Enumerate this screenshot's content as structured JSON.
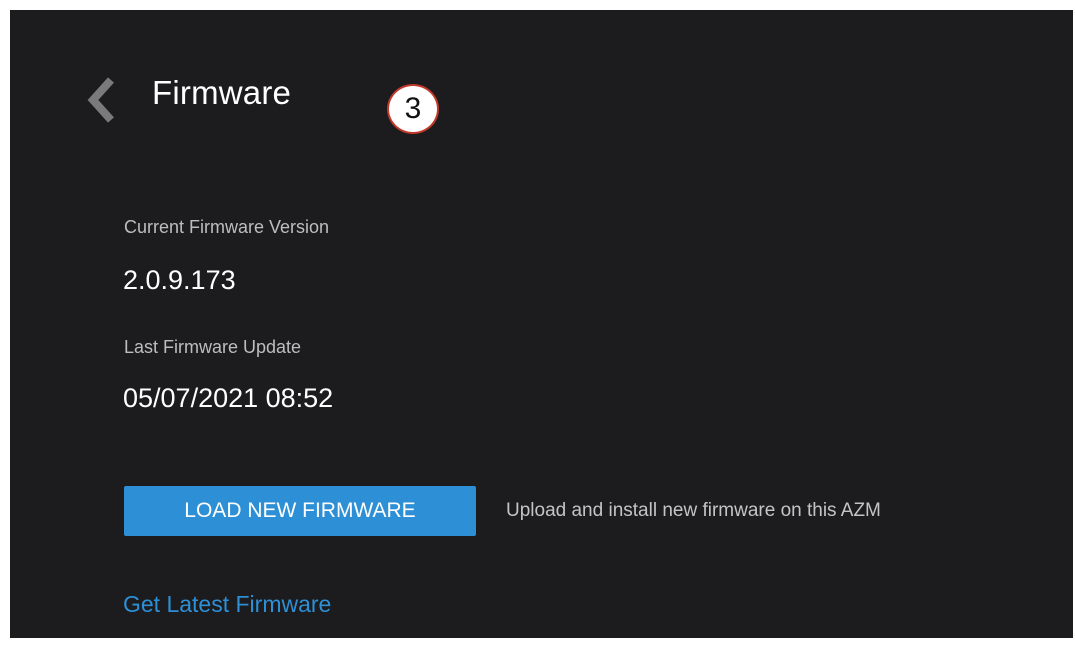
{
  "header": {
    "back_icon": "chevron-left-icon",
    "title": "Firmware",
    "step_badge": "3"
  },
  "firmware": {
    "current_version_label": "Current Firmware Version",
    "current_version_value": "2.0.9.173",
    "last_update_label": "Last Firmware Update",
    "last_update_value": "05/07/2021 08:52"
  },
  "actions": {
    "load_button_label": "LOAD NEW FIRMWARE",
    "load_description": "Upload and install new firmware on this AZM",
    "latest_link_label": "Get Latest Firmware"
  },
  "colors": {
    "background": "#1c1c1e",
    "accent": "#2d8fd6",
    "badge_border": "#c0392b"
  }
}
